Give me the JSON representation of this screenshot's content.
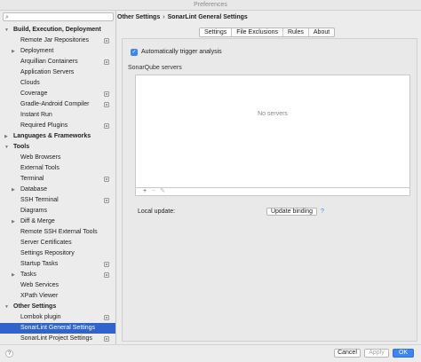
{
  "window": {
    "title": "Preferences"
  },
  "search": {
    "placeholder": "",
    "value": ""
  },
  "sidebar": {
    "items": [
      {
        "label": "Build, Execution, Deployment",
        "level": 0,
        "bold": true,
        "arrow": "open",
        "project": false
      },
      {
        "label": "Remote Jar Repositories",
        "level": 1,
        "bold": false,
        "arrow": "",
        "project": true
      },
      {
        "label": "Deployment",
        "level": 1,
        "bold": false,
        "arrow": "closed",
        "project": false
      },
      {
        "label": "Arquillian Containers",
        "level": 1,
        "bold": false,
        "arrow": "",
        "project": true
      },
      {
        "label": "Application Servers",
        "level": 1,
        "bold": false,
        "arrow": "",
        "project": false
      },
      {
        "label": "Clouds",
        "level": 1,
        "bold": false,
        "arrow": "",
        "project": false
      },
      {
        "label": "Coverage",
        "level": 1,
        "bold": false,
        "arrow": "",
        "project": true
      },
      {
        "label": "Gradle-Android Compiler",
        "level": 1,
        "bold": false,
        "arrow": "",
        "project": true
      },
      {
        "label": "Instant Run",
        "level": 1,
        "bold": false,
        "arrow": "",
        "project": false
      },
      {
        "label": "Required Plugins",
        "level": 1,
        "bold": false,
        "arrow": "",
        "project": true
      },
      {
        "label": "Languages & Frameworks",
        "level": 0,
        "bold": true,
        "arrow": "closed",
        "project": false
      },
      {
        "label": "Tools",
        "level": 0,
        "bold": true,
        "arrow": "open",
        "project": false
      },
      {
        "label": "Web Browsers",
        "level": 1,
        "bold": false,
        "arrow": "",
        "project": false
      },
      {
        "label": "External Tools",
        "level": 1,
        "bold": false,
        "arrow": "",
        "project": false
      },
      {
        "label": "Terminal",
        "level": 1,
        "bold": false,
        "arrow": "",
        "project": true
      },
      {
        "label": "Database",
        "level": 1,
        "bold": false,
        "arrow": "closed",
        "project": false
      },
      {
        "label": "SSH Terminal",
        "level": 1,
        "bold": false,
        "arrow": "",
        "project": true
      },
      {
        "label": "Diagrams",
        "level": 1,
        "bold": false,
        "arrow": "",
        "project": false
      },
      {
        "label": "Diff & Merge",
        "level": 1,
        "bold": false,
        "arrow": "closed",
        "project": false
      },
      {
        "label": "Remote SSH External Tools",
        "level": 1,
        "bold": false,
        "arrow": "",
        "project": false
      },
      {
        "label": "Server Certificates",
        "level": 1,
        "bold": false,
        "arrow": "",
        "project": false
      },
      {
        "label": "Settings Repository",
        "level": 1,
        "bold": false,
        "arrow": "",
        "project": false
      },
      {
        "label": "Startup Tasks",
        "level": 1,
        "bold": false,
        "arrow": "",
        "project": true
      },
      {
        "label": "Tasks",
        "level": 1,
        "bold": false,
        "arrow": "closed",
        "project": true
      },
      {
        "label": "Web Services",
        "level": 1,
        "bold": false,
        "arrow": "",
        "project": false
      },
      {
        "label": "XPath Viewer",
        "level": 1,
        "bold": false,
        "arrow": "",
        "project": false
      },
      {
        "label": "Other Settings",
        "level": 0,
        "bold": true,
        "arrow": "open",
        "project": false
      },
      {
        "label": "Lombok plugin",
        "level": 1,
        "bold": false,
        "arrow": "",
        "project": true
      },
      {
        "label": "SonarLint General Settings",
        "level": 1,
        "bold": false,
        "arrow": "",
        "project": false,
        "selected": true
      },
      {
        "label": "SonarLint Project Settings",
        "level": 1,
        "bold": false,
        "arrow": "",
        "project": true
      }
    ]
  },
  "breadcrumb": {
    "parent": "Other Settings",
    "separator": "›",
    "current": "SonarLint General Settings"
  },
  "tabs": [
    {
      "label": "Settings",
      "active": true
    },
    {
      "label": "File Exclusions",
      "active": false
    },
    {
      "label": "Rules",
      "active": false
    },
    {
      "label": "About",
      "active": false
    }
  ],
  "settings": {
    "auto_trigger_label": "Automatically trigger analysis",
    "auto_trigger_checked": true,
    "servers_label": "SonarQube servers",
    "servers_empty_text": "No servers",
    "toolbar": {
      "add": "+",
      "remove": "−",
      "edit": "✎"
    },
    "local_update_label": "Local update:",
    "update_binding_button": "Update binding",
    "help_mark": "?"
  },
  "footer": {
    "help": "?",
    "cancel": "Cancel",
    "apply": "Apply",
    "ok": "OK"
  }
}
